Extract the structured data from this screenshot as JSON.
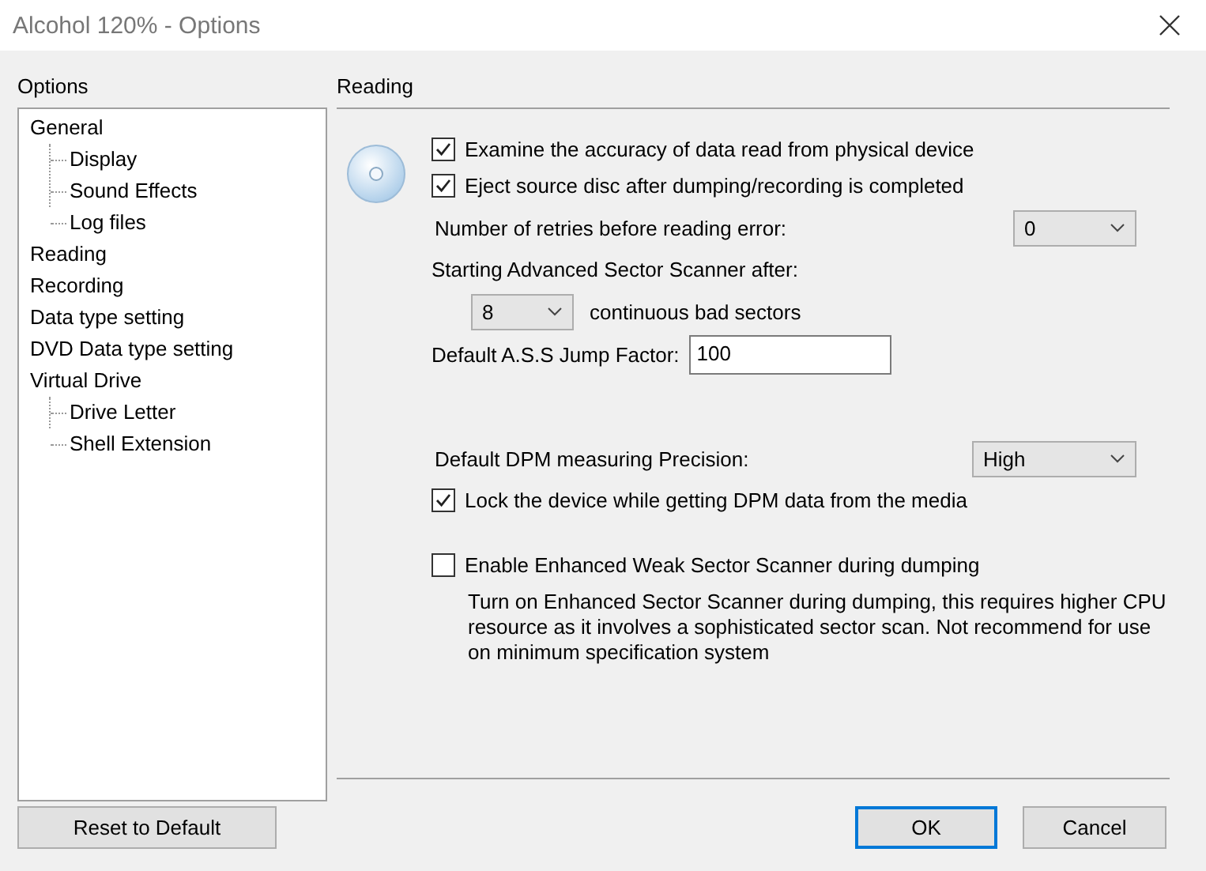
{
  "window": {
    "title": "Alcohol 120% - Options"
  },
  "sidebar": {
    "heading": "Options",
    "tree": [
      {
        "label": "General",
        "children": [
          {
            "label": "Display"
          },
          {
            "label": "Sound Effects"
          },
          {
            "label": "Log files"
          }
        ]
      },
      {
        "label": "Reading"
      },
      {
        "label": "Recording"
      },
      {
        "label": "Data type setting"
      },
      {
        "label": "DVD Data type setting"
      },
      {
        "label": "Virtual Drive",
        "children": [
          {
            "label": "Drive Letter"
          },
          {
            "label": "Shell Extension"
          }
        ]
      }
    ]
  },
  "panel": {
    "heading": "Reading",
    "groups": [
      [
        {
          "kind": "checkbox",
          "label": "Examine the accuracy of data read from physical device",
          "checked": true
        },
        {
          "kind": "checkbox",
          "label": "Eject source disc after dumping/recording is completed",
          "checked": true
        },
        {
          "kind": "select",
          "label": "Number of retries before reading error:",
          "value": "0"
        },
        {
          "kind": "scanner",
          "label": "Starting Advanced Sector Scanner after:",
          "value": "8",
          "suffix": "continuous bad sectors"
        },
        {
          "kind": "input",
          "label": "Default A.S.S Jump Factor:",
          "value": "100"
        }
      ],
      [
        {
          "kind": "select",
          "label": "Default DPM measuring Precision:",
          "value": "High"
        },
        {
          "kind": "checkbox",
          "label": "Lock the device while getting DPM data from the media",
          "checked": true
        }
      ],
      [
        {
          "kind": "checkbox",
          "label": "Enable Enhanced Weak Sector Scanner during dumping",
          "checked": false
        },
        {
          "kind": "description",
          "label": "Turn on Enhanced Sector Scanner during dumping, this requires higher CPU resource as it involves a sophisticated sector scan. Not recommend for use on minimum specification system"
        }
      ]
    ]
  },
  "buttons": {
    "reset": "Reset to Default",
    "ok": "OK",
    "cancel": "Cancel"
  }
}
